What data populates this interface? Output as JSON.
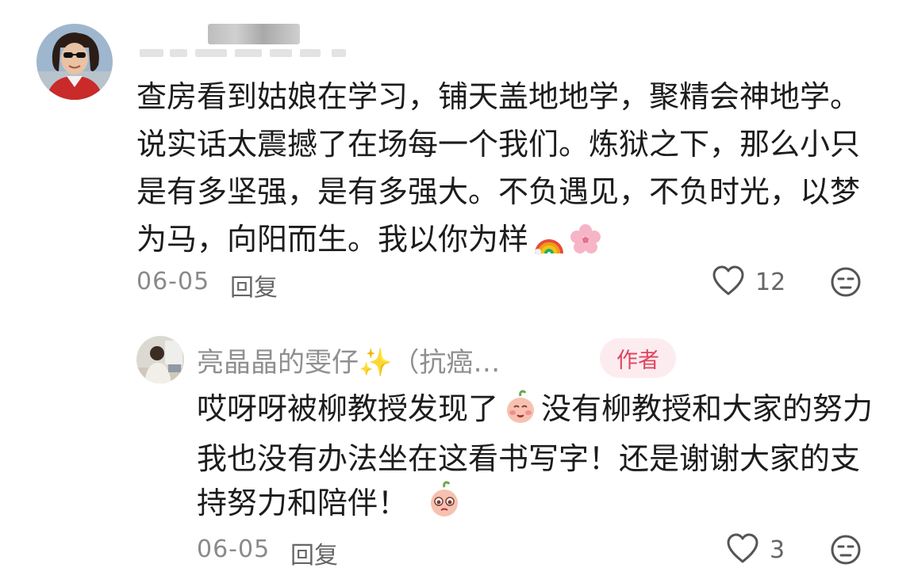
{
  "comment": {
    "text": "查房看到姑娘在学习，铺天盖地地学，聚精会神地学。说实话太震撼了在场每一个我们。炼狱之下，那么小只是有多坚强，是有多强大。不负遇见，不负时光，以梦为马，向阳而生。我以你为样",
    "emojis": [
      "rainbow-emoji",
      "cherry-blossom-emoji"
    ],
    "date": "06-05",
    "reply_label": "回复",
    "likes": "12"
  },
  "reply": {
    "author": "亮晶晶的雯仔✨（抗癌…",
    "badge": "作者",
    "text_part1": "哎呀呀被柳教授发现了",
    "text_part2": "没有柳教授和大家的努力我也没有办法坐在这看书写字！还是谢谢大家的支持努力和陪伴！",
    "emojis": [
      "shy-peach-emoji",
      "teary-peach-emoji"
    ],
    "date": "06-05",
    "reply_label": "回复",
    "likes": "3"
  },
  "colors": {
    "badge_bg": "#fdecef",
    "badge_text": "#e0445f",
    "meta_text": "#8a8a8a"
  }
}
